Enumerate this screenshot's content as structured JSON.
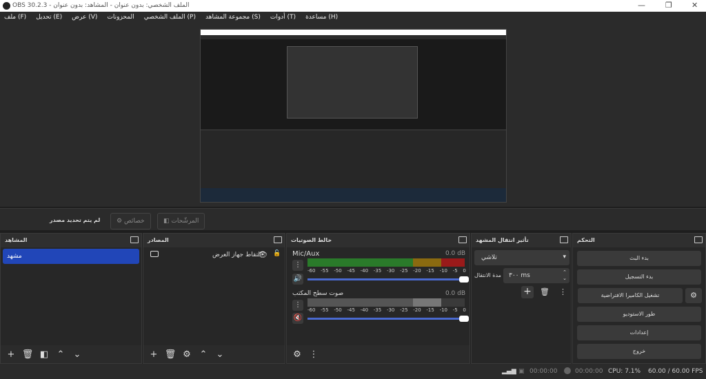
{
  "window": {
    "title": "OBS 30.2.3 - الملف الشخصي: بدون عنوان - المشاهد: بدون عنوان",
    "min": "—",
    "max": "❐",
    "close": "✕"
  },
  "menu": [
    "ملف (F)",
    "تحديل (E)",
    "عرض (V)",
    "المحزونات",
    "الملف الشخصي (P)",
    "مجموعة المشاهد (S)",
    "أدوات (T)",
    "مساعدة (H)"
  ],
  "context": {
    "no_source": "لم يتم تحديد مصدر",
    "properties": "خصائص",
    "filters": "المرشّحات"
  },
  "scenes": {
    "title": "المشاهد",
    "items": [
      "مشهد"
    ]
  },
  "sources": {
    "title": "المصادر",
    "items": [
      "التقاط جهاز العرض"
    ]
  },
  "mixer": {
    "title": "خالط الصوتيات",
    "channels": [
      {
        "name": "Mic/Aux",
        "db": "0.0 dB",
        "muted": false
      },
      {
        "name": "صوت سطح المكتب",
        "db": "0.0 dB",
        "muted": true
      }
    ],
    "ticks": [
      "-60",
      "-55",
      "-50",
      "-45",
      "-40",
      "-35",
      "-30",
      "-25",
      "-20",
      "-15",
      "-10",
      "-5",
      "0"
    ]
  },
  "transitions": {
    "title": "تأثير انتقال المشهد",
    "selected": "تلاشي",
    "duration_label": "مدة الانتقال",
    "duration": "٣٠٠ ms"
  },
  "controls": {
    "title": "التحكم",
    "start_stream": "بدء البث",
    "start_record": "بدء التسجيل",
    "virtual_cam": "تشغيل الكاميرا الافتراضية",
    "studio": "طور الاستوديو",
    "settings": "إعدادات",
    "exit": "خروج"
  },
  "status": {
    "stream_time": "00:00:00",
    "record_time": "00:00:00",
    "cpu": "CPU: 7.1%",
    "fps": "60.00 / 60.00 FPS"
  }
}
